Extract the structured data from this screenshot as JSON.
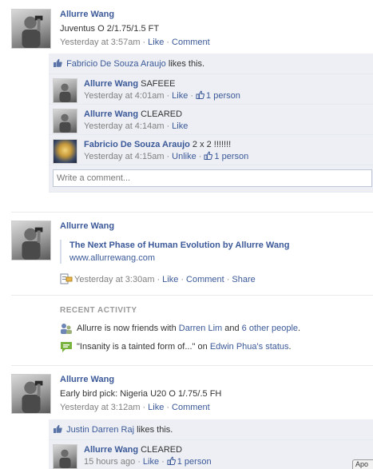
{
  "posts": [
    {
      "author": "Allurre Wang",
      "text": "Juventus O 2/1.75/1.5 FT",
      "time": "Yesterday at 3:57am",
      "like_label": "Like",
      "comment_label": "Comment",
      "likes": {
        "name": "Fabricio De Souza Araujo",
        "suffix": "likes this."
      },
      "comments": [
        {
          "author": "Allurre Wang",
          "text": "SAFEEE",
          "time": "Yesterday at 4:01am",
          "action": "Like",
          "likes": "1 person"
        },
        {
          "author": "Allurre Wang",
          "text": "CLEARED",
          "time": "Yesterday at 4:14am",
          "action": "Like",
          "likes": ""
        },
        {
          "author": "Fabricio De Souza Araujo",
          "text": "2 x 2 !!!!!!!",
          "time": "Yesterday at 4:15am",
          "action": "Unlike",
          "likes": "1 person"
        }
      ],
      "write_placeholder": "Write a comment..."
    },
    {
      "author": "Allurre Wang",
      "share_title": "The Next Phase of Human Evolution by Allurre Wang",
      "share_url": "www.allurrewang.com",
      "time": "Yesterday at 3:30am",
      "like_label": "Like",
      "comment_label": "Comment",
      "share_label": "Share"
    },
    {
      "author": "Allurre Wang",
      "text": "Early bird pick: Nigeria U20 O 1/.75/.5 FH",
      "time": "Yesterday at 3:12am",
      "like_label": "Like",
      "comment_label": "Comment",
      "likes": {
        "name": "Justin Darren Raj",
        "suffix": "likes this."
      },
      "comments": [
        {
          "author": "Allurre Wang",
          "text": "CLEARED",
          "time": "15 hours ago",
          "action": "Like",
          "likes": "1 person"
        }
      ]
    }
  ],
  "recent_activity": {
    "heading": "RECENT ACTIVITY",
    "friends": {
      "prefix": "Allurre is now friends with",
      "friend": "Darren Lim",
      "and": "and",
      "others": "6 other people",
      "end": "."
    },
    "status": {
      "quote": "\"Insanity is a tainted form of...\"",
      "on": "on",
      "owner": "Edwin Phua's",
      "link": "status",
      "end": "."
    }
  },
  "corner_chip": "Apo"
}
